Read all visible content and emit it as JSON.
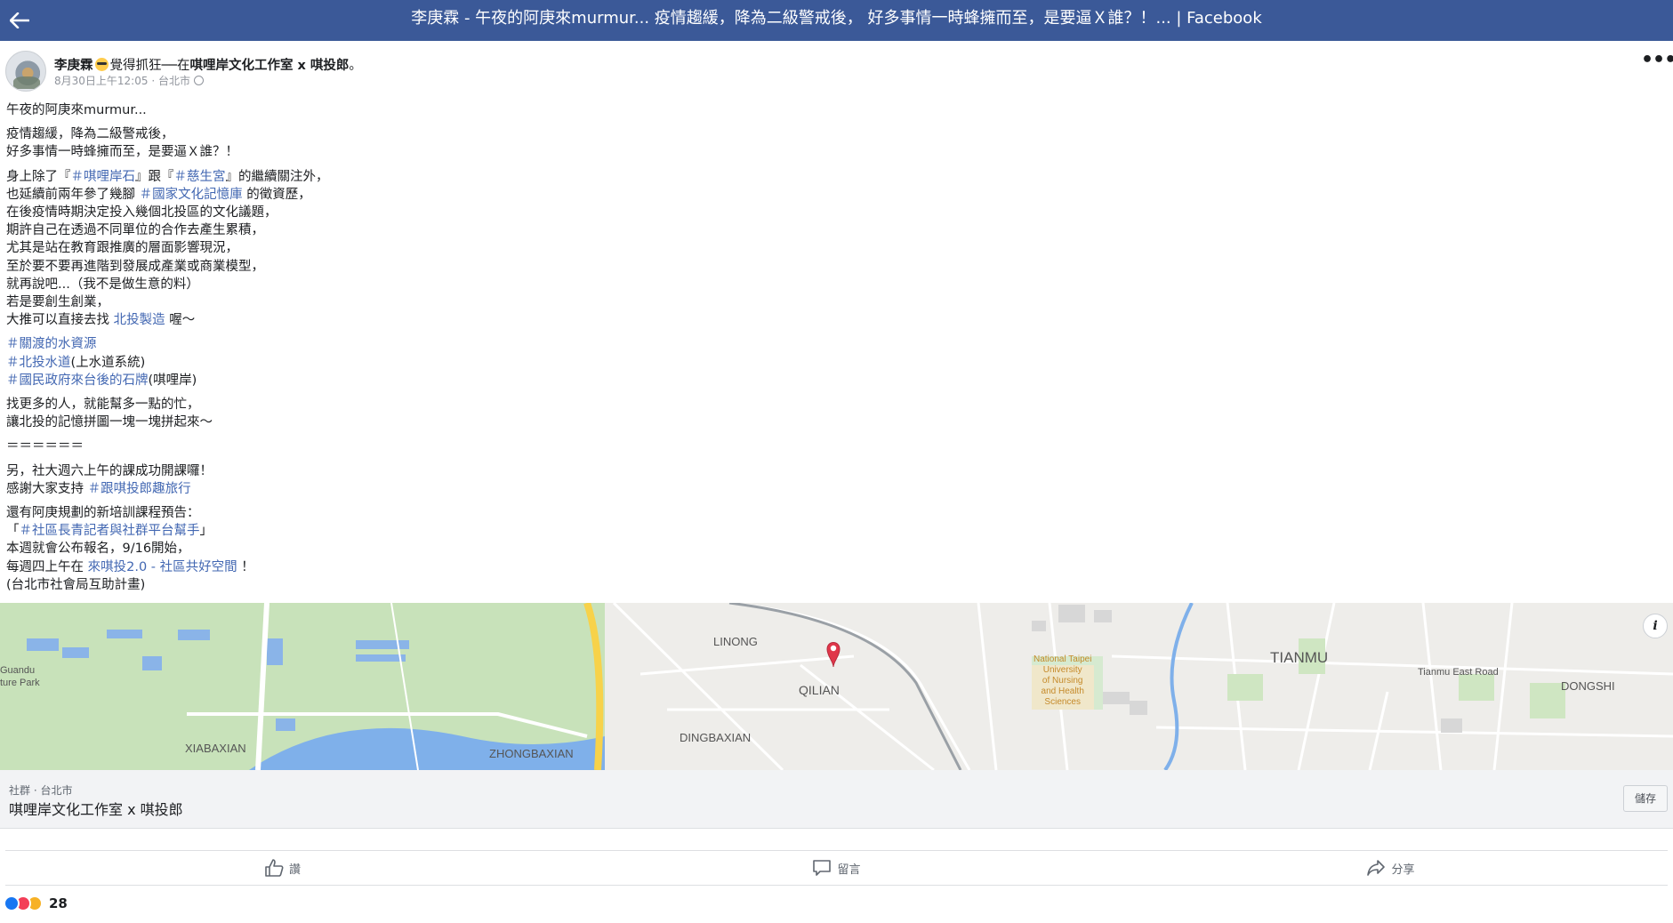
{
  "header": {
    "title": "李庚霖 - 午夜的阿庚來murmur... 疫情趨緩，降為二級警戒後， 好多事情一時蜂擁而至，是要逼Ｘ誰？！... | Facebook",
    "back_icon": "back-arrow-icon"
  },
  "post": {
    "author": "李庚霖",
    "feeling": "覺得抓狂──在",
    "page": "唭哩岸文化工作室 x 唭投郎",
    "period": "。",
    "timestamp": "8月30日上午12:05",
    "location": "台北市",
    "more_label": "•••",
    "body": {
      "p1": "午夜的阿庚來murmur...",
      "p2_l1": "疫情趨緩，降為二級警戒後，",
      "p2_l2": "好多事情一時蜂擁而至，是要逼Ｘ誰？！",
      "p3_l1_a": "身上除了『",
      "p3_l1_tag1": "＃唭哩岸石",
      "p3_l1_b": "』跟『",
      "p3_l1_tag2": "＃慈生宮",
      "p3_l1_c": "』的繼續關注外，",
      "p3_l2_a": "也延續前兩年參了幾腳 ",
      "p3_l2_tag": "＃國家文化記憶庫",
      "p3_l2_b": " 的徵資歷，",
      "p3_l3": "在後疫情時期決定投入幾個北投區的文化議題，",
      "p3_l4": "期許自己在透過不同單位的合作去產生累積，",
      "p3_l5": "尤其是站在教育跟推廣的層面影響現況，",
      "p3_l6": "至於要不要再進階到發展成產業或商業模型，",
      "p3_l7": "就再說吧...（我不是做生意的料）",
      "p3_l8": "若是要創生創業，",
      "p3_l9_a": "大推可以直接去找 ",
      "p3_l9_link": "北投製造",
      "p3_l9_b": " 喔～",
      "p4_l1_tag": "＃關渡的水資源",
      "p4_l2_tag": "＃北投水道",
      "p4_l2_b": "(上水道系統)",
      "p4_l3_tag": "＃國民政府來台後的石牌",
      "p4_l3_b": "(唭哩岸)",
      "p5_l1": "找更多的人，就能幫多一點的忙，",
      "p5_l2": "讓北投的記憶拼圖一塊一塊拼起來～",
      "p6": "＝＝＝＝＝＝",
      "p7_l1": "另，社大週六上午的課成功開課囉！",
      "p7_l2_a": "感謝大家支持 ",
      "p7_l2_tag": "＃跟唭投郎趣旅行",
      "p8_l1": "還有阿庚規劃的新培訓課程預告：",
      "p8_l2_a": "「",
      "p8_l2_tag": "＃社區長青記者與社群平台幫手",
      "p8_l2_b": "」",
      "p8_l3": "本週就會公布報名，9/16開始，",
      "p8_l4_a": "每週四上午在 ",
      "p8_l4_link": "來唭投2.0 - 社區共好空間",
      "p8_l4_b": " ！",
      "p8_l5": "(台北市社會局互助計畫)"
    }
  },
  "map": {
    "labels": {
      "guandu": "Guandu",
      "nature_park": "ture Park",
      "xiabaxian": "XIABAXIAN",
      "zhongbaxian": "ZHONGBAXIAN",
      "linong": "LINONG",
      "qilian": "QILIAN",
      "dingbaxian": "DINGBAXIAN",
      "tianmu": "TIANMU",
      "dongshi": "DONGSHI",
      "tianmu_east_road": "Tianmu East Road",
      "national_taipei": "National Taipei\nUniversity\nof Nursing\nand Health\nSciences"
    },
    "info_label": "i"
  },
  "place": {
    "category": "社群 · 台北市",
    "name": "唭哩岸文化工作室 x 唭投郎",
    "save_label": "儲存"
  },
  "actions": {
    "like_label": "讚",
    "comment_label": "留言",
    "share_label": "分享"
  },
  "reactions": {
    "count": "28"
  }
}
